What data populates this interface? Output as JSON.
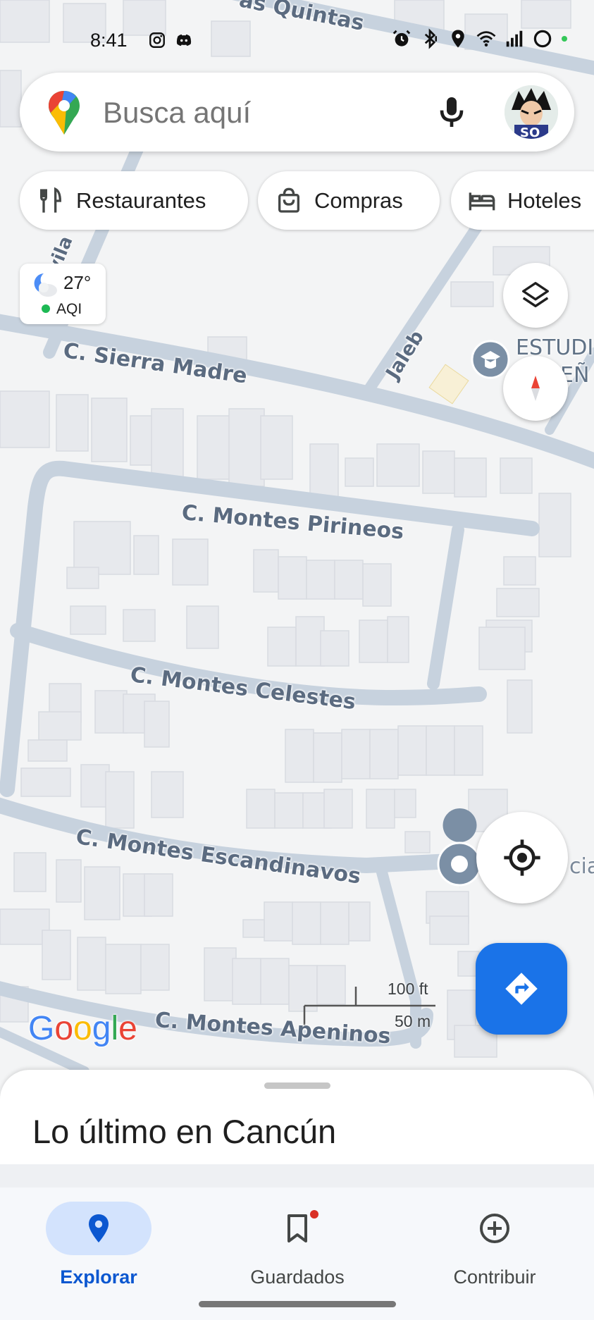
{
  "status_bar": {
    "time": "8:41",
    "left_icons": [
      "instagram-icon",
      "discord-icon"
    ],
    "right_icons": [
      "alarm-icon",
      "bluetooth-icon",
      "location-icon",
      "wifi-icon",
      "signal-icon",
      "battery-ring-icon"
    ]
  },
  "search": {
    "placeholder": "Busca aquí"
  },
  "chips": [
    {
      "label": "Restaurantes",
      "icon": "fork-knife-icon"
    },
    {
      "label": "Compras",
      "icon": "shopping-bag-icon"
    },
    {
      "label": "Hoteles",
      "icon": "bed-icon"
    }
  ],
  "weather": {
    "temperature": "27°",
    "aqi_label": "AQI"
  },
  "map": {
    "streets": {
      "quintas": "as Quintas",
      "sierra_madre": "C. Sierra Madre",
      "jaleb": "Jaleb",
      "montes_pirineos": "C. Montes Pirineos",
      "montes_celestes": "C. Montes Celestes",
      "montes_escandinavos": "C. Montes Escandinavos",
      "montes_apeninos": "C. Montes Apeninos",
      "avila": "vila"
    },
    "poi_label_line1": "ESTUDI",
    "poi_label_line2": "EÑ",
    "partial_label_right": "cia",
    "scale_ft": "100 ft",
    "scale_m": "50 m",
    "google_letters": [
      "G",
      "o",
      "o",
      "g",
      "l",
      "e"
    ],
    "google_colors": [
      "#4285F4",
      "#EA4335",
      "#FBBC05",
      "#4285F4",
      "#34A853",
      "#EA4335"
    ]
  },
  "sheet": {
    "title": "Lo último en Cancún"
  },
  "nav": {
    "explore": "Explorar",
    "saved": "Guardados",
    "contribute": "Contribuir"
  },
  "colors": {
    "accent": "#1a73e8",
    "nav_active": "#0b57d0",
    "road": "#c7d2de",
    "building": "#e6e8ec"
  }
}
